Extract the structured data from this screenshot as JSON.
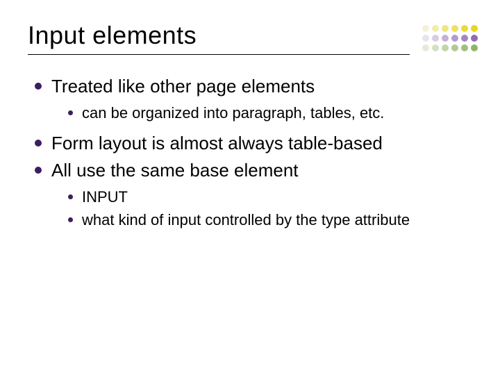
{
  "title": "Input elements",
  "bullets": [
    {
      "text": "Treated like other page elements",
      "sub": [
        {
          "text": "can be organized into paragraph, tables, etc."
        }
      ]
    },
    {
      "text": "Form layout is almost always table-based",
      "sub": []
    },
    {
      "text": "All use the same base element",
      "sub": [
        {
          "text": "INPUT"
        },
        {
          "text": "what kind of input controlled by the type attribute"
        }
      ]
    }
  ],
  "decor_dot_colors": [
    "#f5f1d8",
    "#f3ecae",
    "#efe581",
    "#ece162",
    "#e9db3c",
    "#e7d71e",
    "#e9e2f0",
    "#d9cbe6",
    "#c6b0da",
    "#b69ace",
    "#a685c3",
    "#926bb5",
    "#e4ecd9",
    "#d3e1c2",
    "#c0d5a9",
    "#b0ca92",
    "#9fc07b",
    "#8fb565"
  ]
}
